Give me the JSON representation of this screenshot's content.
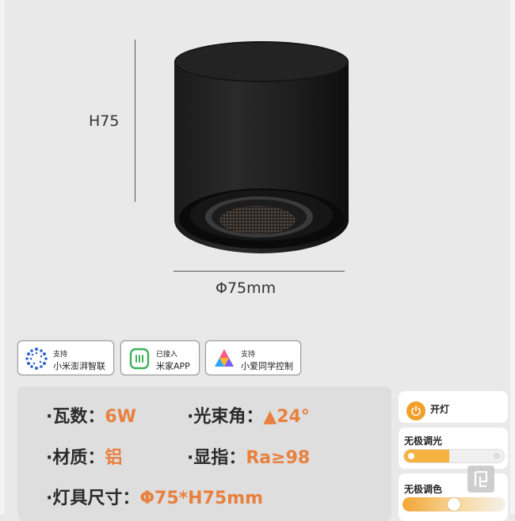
{
  "drawing": {
    "height_label": "H75",
    "width_label": "Φ75mm"
  },
  "badges": [
    {
      "icon": "xiaomi-connect-icon",
      "line1": "支持",
      "line2": "小米澎湃智联"
    },
    {
      "icon": "mijia-icon",
      "line1": "已接入",
      "line2": "米家APP"
    },
    {
      "icon": "xiaoai-icon",
      "line1": "支持",
      "line2": "小爱同学控制"
    }
  ],
  "specs": {
    "power": {
      "key": "·瓦数：",
      "value": "6W"
    },
    "beam": {
      "key": "·光束角：",
      "value": "▲24°"
    },
    "material": {
      "key": "·材质：",
      "value": "铝"
    },
    "cri": {
      "key": "·显指：",
      "value": "Ra≥98"
    },
    "size": {
      "key": "·灯具尺寸：",
      "value": "Φ75*H75mm"
    }
  },
  "controls": {
    "power_label": "开灯",
    "dimming_label": "无极调光",
    "dimming_level": 0.45,
    "color_label": "无极调色",
    "color_level": 0.5
  },
  "colors": {
    "accent": "#e8803e",
    "slider": "#f5b240"
  }
}
